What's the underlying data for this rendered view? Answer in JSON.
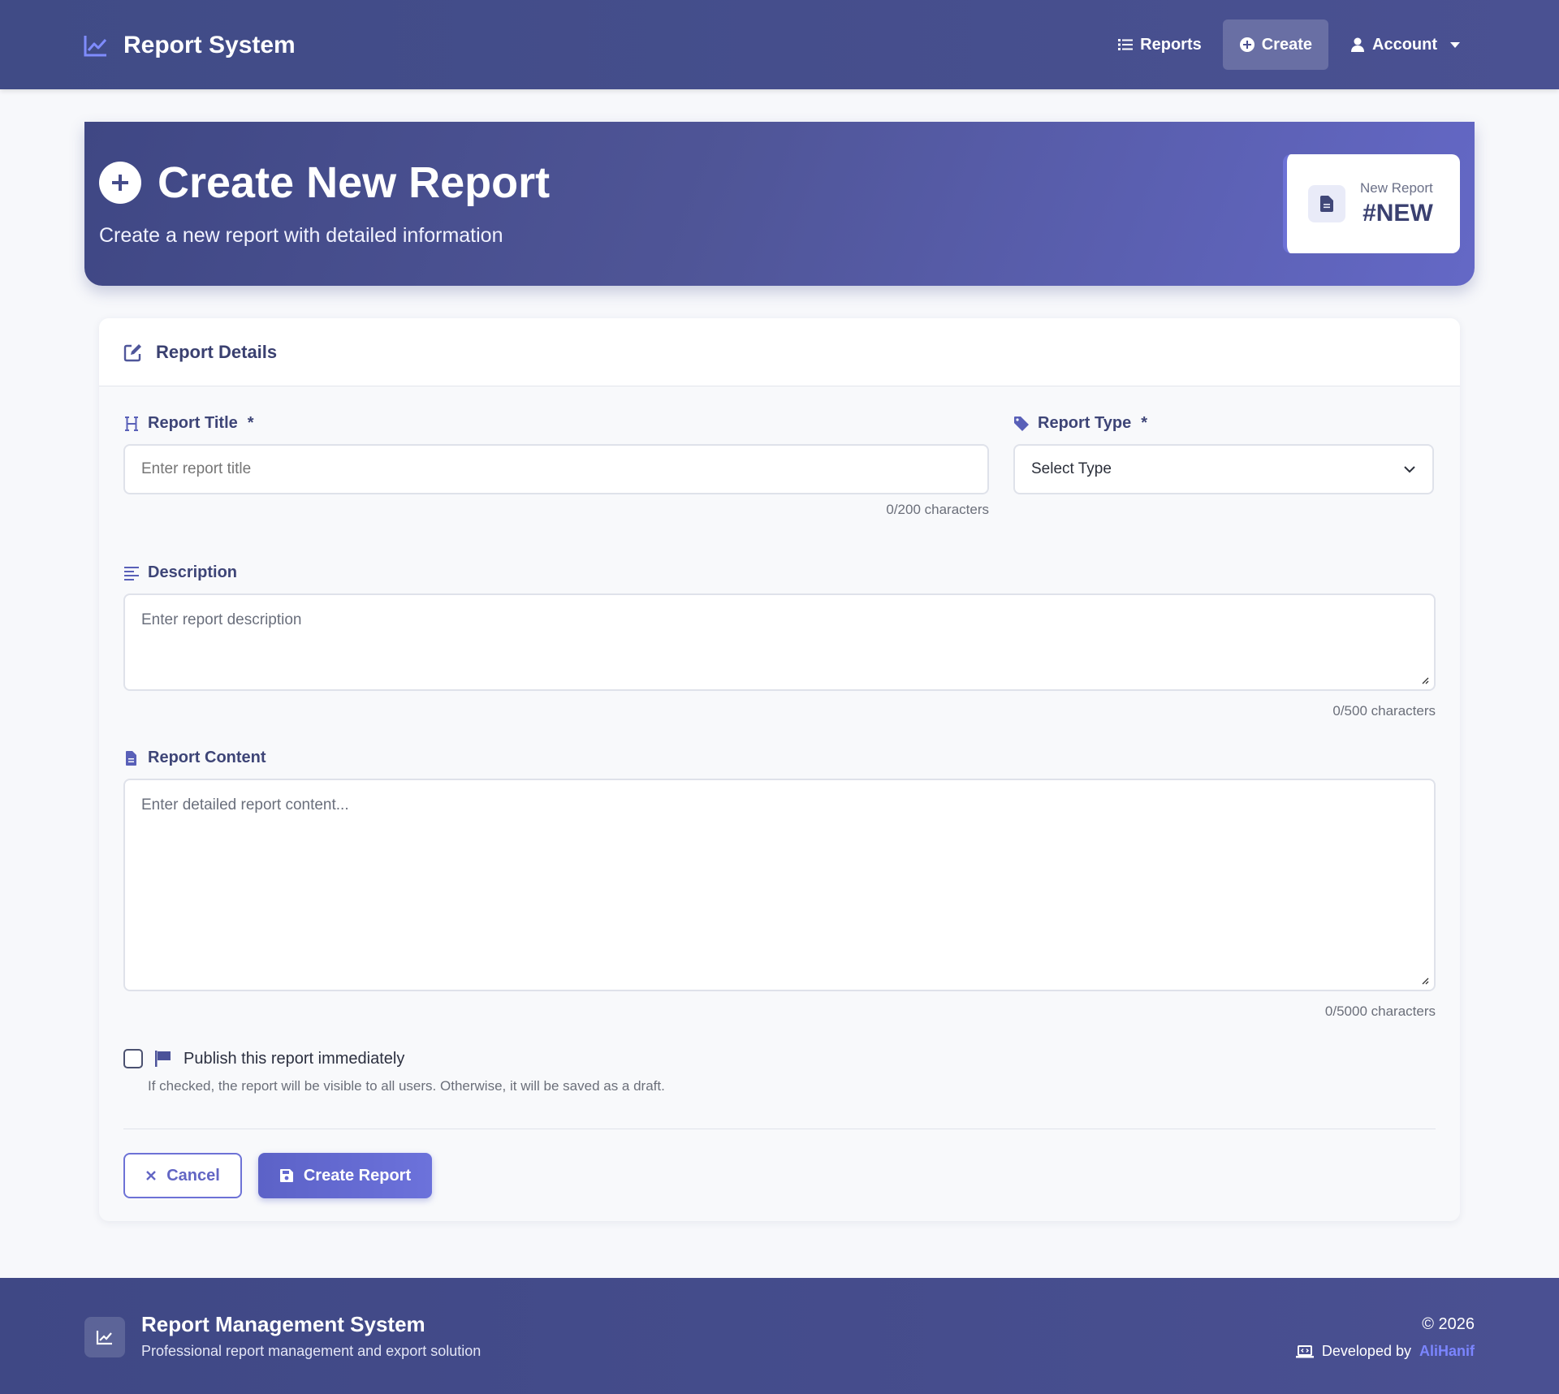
{
  "navbar": {
    "brand": "Report System",
    "links": [
      {
        "label": "Reports",
        "icon": "list-icon"
      },
      {
        "label": "Create",
        "icon": "plus-circle-icon",
        "active": true
      },
      {
        "label": "Account",
        "icon": "user-icon"
      }
    ]
  },
  "hero": {
    "title": "Create New Report",
    "subtitle": "Create a new report with detailed information",
    "card_label": "New Report",
    "card_value": "#NEW"
  },
  "form": {
    "header": "Report Details",
    "title_label": "Report Title",
    "title_placeholder": "Enter report title",
    "title_counter": "0/200 characters",
    "type_label": "Report Type",
    "type_selected": "Select Type",
    "description_label": "Description",
    "description_placeholder": "Enter report description",
    "description_counter": "0/500 characters",
    "content_label": "Report Content",
    "content_placeholder": "Enter detailed report content...",
    "content_counter": "0/5000 characters",
    "publish_label": "Publish this report immediately",
    "publish_help": "If checked, the report will be visible to all users. Otherwise, it will be saved as a draft.",
    "required_mark": "*",
    "cancel_label": "Cancel",
    "create_label": "Create Report"
  },
  "footer": {
    "title": "Report Management System",
    "subtitle": "Professional report management and export solution",
    "copyright": "© 2026",
    "developed_by": "Developed by",
    "author": "AliHanif"
  },
  "colors": {
    "primary": "#4a5092",
    "accent": "#6d72d6",
    "author_link": "#7b85ff"
  }
}
